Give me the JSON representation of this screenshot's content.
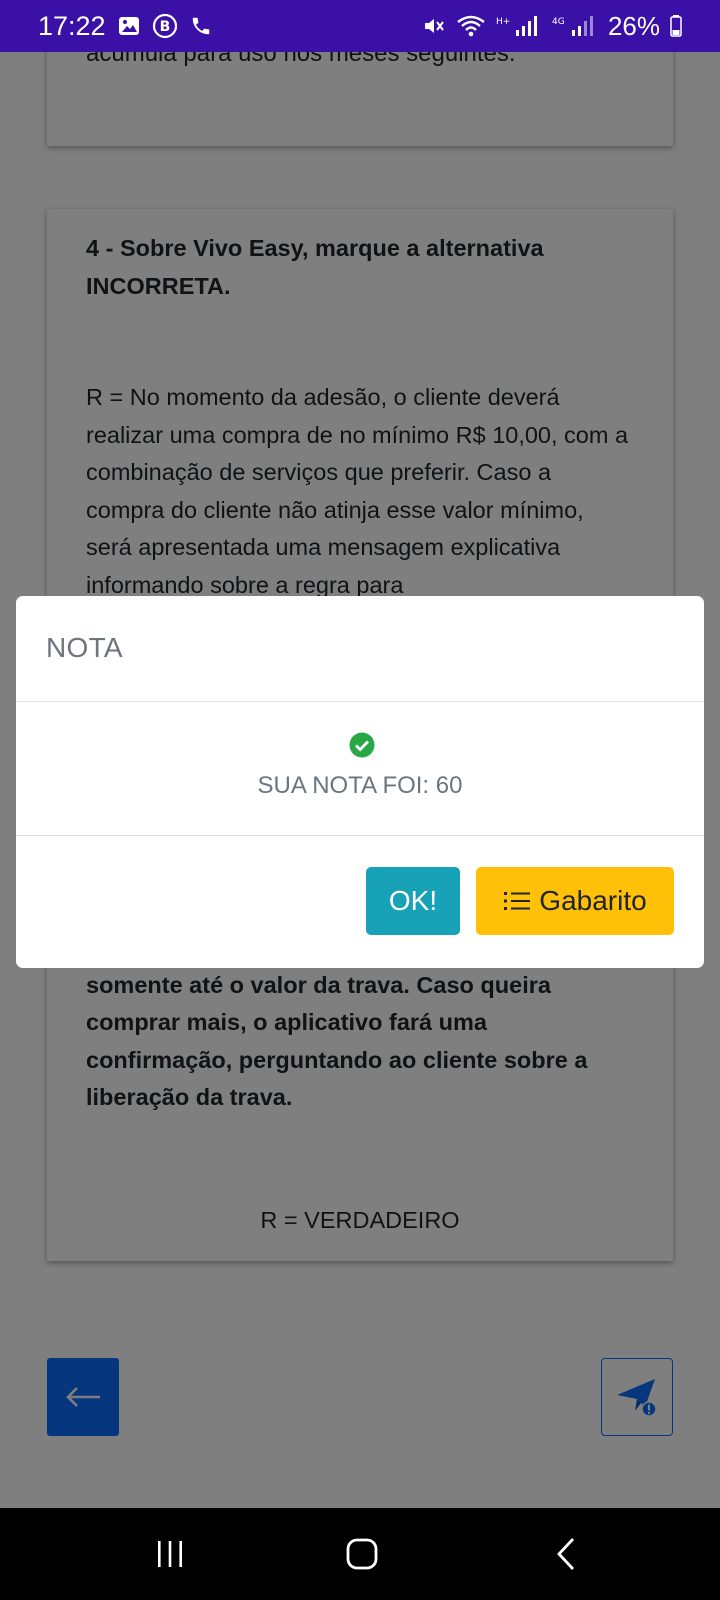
{
  "status_bar": {
    "time": "17:22",
    "battery": "26%"
  },
  "background_page": {
    "prev_card_text": "acumula para uso nos meses seguintes.",
    "question_title": "4 - Sobre Vivo Easy, marque a alternativa INCORRETA.",
    "answer_paragraph": "R = No momento da adesão, o cliente deverá realizar uma compra de no mínimo R$ 10,00, com a combinação de serviços que preferir. Caso a compra do cliente não atinja esse valor mínimo, será apresentada uma mensagem explicativa informando sobre a regra para",
    "bold_paragraph": "quer gastar no mês, e a compra será feita somente até o valor da trava. Caso queira comprar mais, o aplicativo fará uma confirmação, perguntando ao cliente sobre a liberação da trava.",
    "answer_label": "R = VERDADEIRO"
  },
  "modal": {
    "title": "NOTA",
    "score_text": "SUA NOTA FOI: 60",
    "ok_label": "OK!",
    "gabarito_label": "Gabarito"
  },
  "colors": {
    "status_bar": "#3b10a6",
    "ok_button": "#17a2b8",
    "gabarito_button": "#ffc107",
    "primary": "#0d6efd",
    "success": "#28a745"
  },
  "icons": [
    "image-icon",
    "b-icon",
    "phone-icon",
    "mute-icon",
    "wifi-icon",
    "signal-icon",
    "battery-icon",
    "check-circle-icon",
    "list-icon",
    "arrow-left-icon",
    "send-alert-icon",
    "recents-icon",
    "home-icon",
    "back-icon"
  ]
}
